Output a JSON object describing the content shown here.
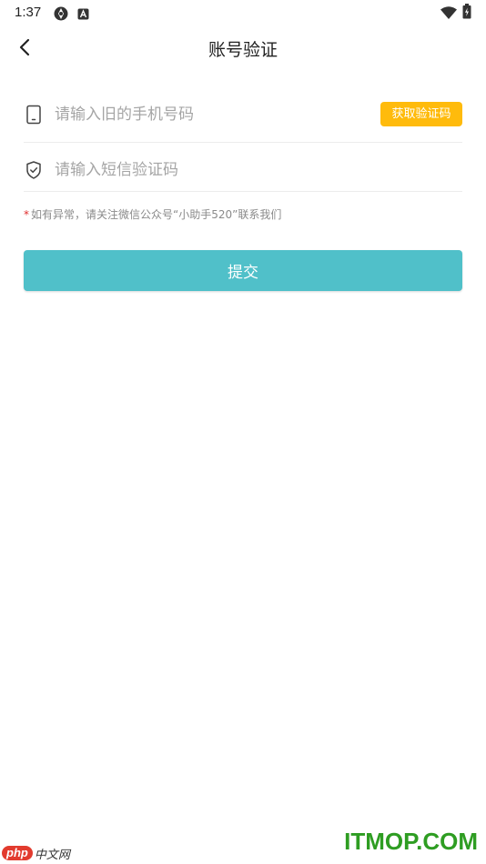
{
  "status_bar": {
    "time": "1:37",
    "icons": [
      "settings-icon",
      "a-icon",
      "wifi-icon",
      "battery-icon"
    ]
  },
  "header": {
    "title": "账号验证",
    "back_icon": "chevron-left-icon"
  },
  "form": {
    "phone": {
      "icon": "phone-icon",
      "placeholder": "请输入旧的手机号码",
      "value": ""
    },
    "get_code_label": "获取验证码",
    "code": {
      "icon": "shield-check-icon",
      "placeholder": "请输入短信验证码",
      "value": ""
    }
  },
  "notice": {
    "star": "*",
    "text": "如有异常，请关注微信公众号“小助手520”联系我们"
  },
  "submit_label": "提交",
  "watermarks": {
    "left_php": "php",
    "left_cn": "中文网",
    "right": "ITMOP.COM"
  },
  "colors": {
    "accent": "#50c0c9",
    "get_code": "#ffbb0c",
    "star": "#e02e2e",
    "watermark_right": "#2e9d22",
    "watermark_php": "#e23b2e"
  }
}
